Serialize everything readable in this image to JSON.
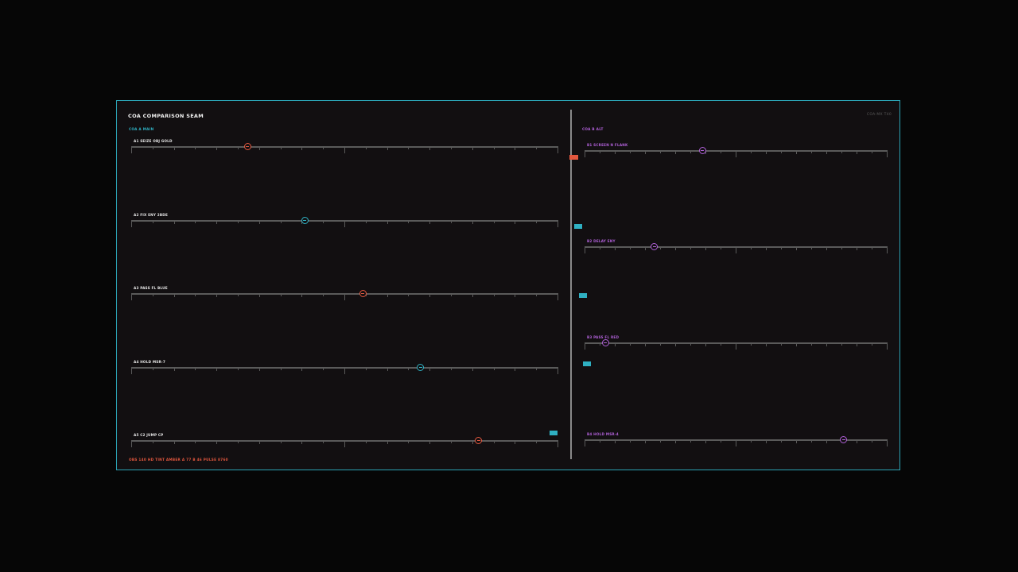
{
  "header": {
    "title": "COA COMPARISON SEAM",
    "code": "COA-MX T40"
  },
  "colors": {
    "frame": "#2ba3b4",
    "orange": "#e2573e",
    "cyan": "#2fb0c2",
    "magenta": "#b060d8"
  },
  "left_panel": {
    "label": "COA A  MAIN",
    "rows": [
      {
        "label": "A1  SEIZE OBJ GOLD",
        "value": 0.274,
        "color": "orange"
      },
      {
        "label": "A2  FIX ENY 2BDE",
        "value": 0.408,
        "color": "cyan"
      },
      {
        "label": "A3  PASS FL BLUE",
        "value": 0.544,
        "color": "orange"
      },
      {
        "label": "A4  HOLD MSR-7",
        "value": 0.68,
        "color": "cyan"
      },
      {
        "label": "A5  C2 JUMP CP",
        "value": 0.816,
        "color": "orange"
      }
    ]
  },
  "right_panel": {
    "label": "COA B  ALT",
    "rows": [
      {
        "label": "B1  SCREEN N FLANK",
        "value": 0.392,
        "color": "magenta"
      },
      {
        "label": "B2  DELAY ENY",
        "value": 0.232,
        "color": "magenta"
      },
      {
        "label": "B3  PASS FL RED",
        "value": 0.071,
        "color": "magenta"
      },
      {
        "label": "B4  HOLD MSR-4",
        "value": 0.858,
        "color": "magenta"
      }
    ]
  },
  "seam_flags": [
    {
      "color": "orange"
    },
    {
      "color": "cyan"
    },
    {
      "color": "cyan"
    },
    {
      "color": "cyan"
    },
    {
      "color": "cyan"
    }
  ],
  "footer": {
    "status": "OBS 140 HD  TINT AMBER  A 77  B 46  PULSE 8760"
  }
}
